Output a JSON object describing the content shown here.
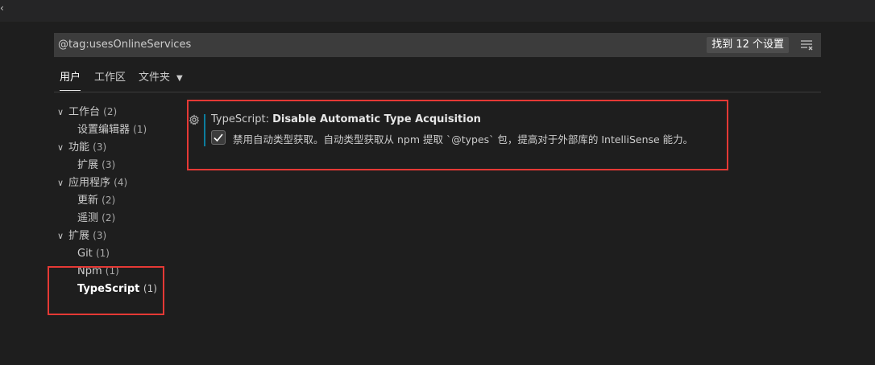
{
  "search": {
    "value": "@tag:usesOnlineServices",
    "count_badge": "找到 12 个设置"
  },
  "tabs": [
    {
      "label": "用户",
      "active": true
    },
    {
      "label": "工作区",
      "active": false
    },
    {
      "label": "文件夹",
      "active": false
    }
  ],
  "toc": [
    {
      "label": "工作台",
      "count": "(2)",
      "expanded": true
    },
    {
      "label": "设置编辑器",
      "count": "(1)"
    },
    {
      "label": "功能",
      "count": "(3)",
      "expanded": true
    },
    {
      "label": "扩展",
      "count": "(3)"
    },
    {
      "label": "应用程序",
      "count": "(4)",
      "expanded": true
    },
    {
      "label": "更新",
      "count": "(2)"
    },
    {
      "label": "遥测",
      "count": "(2)"
    },
    {
      "label": "扩展",
      "count": "(3)",
      "expanded": true
    },
    {
      "label": "Git",
      "count": "(1)"
    },
    {
      "label": "Npm",
      "count": "(1)"
    },
    {
      "label": "TypeScript",
      "count": "(1)",
      "selected": true
    }
  ],
  "setting": {
    "category": "TypeScript: ",
    "name": "Disable Automatic Type Acquisition",
    "checked": true,
    "description": "禁用自动类型获取。自动类型获取从 npm 提取 `@types` 包，提高对于外部库的 IntelliSense 能力。"
  },
  "colors": {
    "background": "#1e1e1e",
    "highlight_border": "#e53935",
    "modified_indicator": "#0c7d9d"
  }
}
